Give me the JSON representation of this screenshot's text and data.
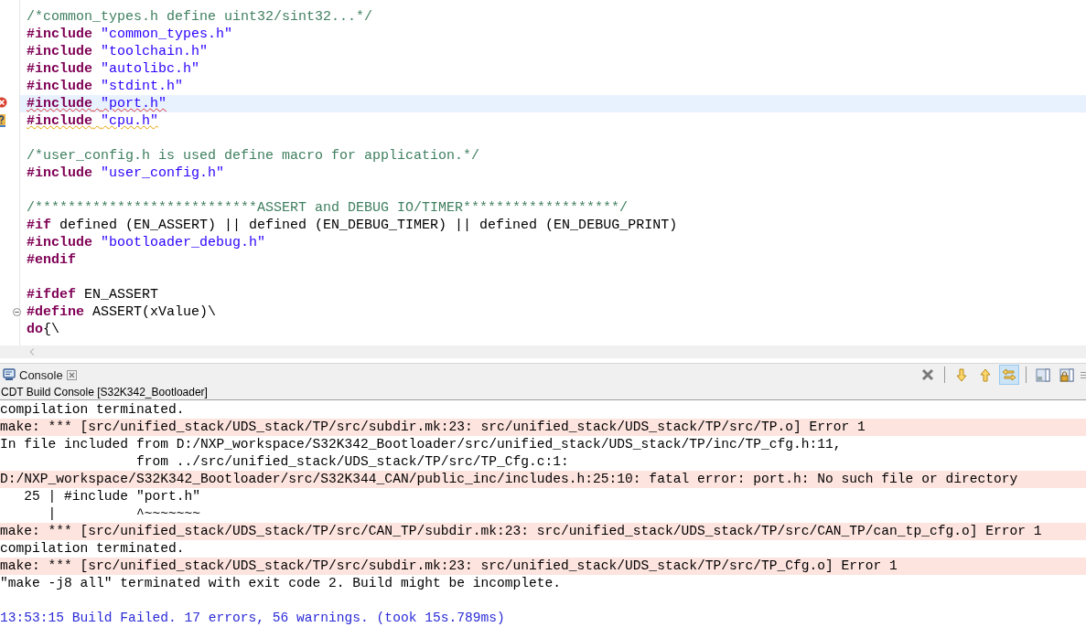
{
  "editor": {
    "lines": [
      {
        "parts": [
          {
            "kind": "comment",
            "text": "/*common_types.h define uint32/sint32...*/"
          }
        ]
      },
      {
        "parts": [
          {
            "kind": "keyword",
            "text": "#include"
          },
          {
            "kind": "string",
            "text": "\"common_types.h\""
          }
        ]
      },
      {
        "parts": [
          {
            "kind": "keyword",
            "text": "#include"
          },
          {
            "kind": "string",
            "text": "\"toolchain.h\""
          }
        ]
      },
      {
        "parts": [
          {
            "kind": "keyword",
            "text": "#include"
          },
          {
            "kind": "string",
            "text": "\"autolibc.h\""
          }
        ]
      },
      {
        "parts": [
          {
            "kind": "keyword",
            "text": "#include"
          },
          {
            "kind": "string",
            "text": "\"stdint.h\""
          }
        ]
      },
      {
        "parts": [
          {
            "kind": "keyword",
            "text": "#include"
          },
          {
            "kind": "string",
            "text": "\"port.h\""
          }
        ],
        "error": true,
        "selected": true
      },
      {
        "parts": [
          {
            "kind": "keyword",
            "text": "#include"
          },
          {
            "kind": "string",
            "text": "\"cpu.h\""
          }
        ],
        "warning": true
      },
      {
        "parts": [
          {
            "kind": "comment",
            "text": "/*user_config.h is used define macro for application.*/"
          }
        ],
        "space_before": true
      },
      {
        "parts": [
          {
            "kind": "keyword",
            "text": "#include"
          },
          {
            "kind": "string",
            "text": "\"user_config.h\""
          }
        ]
      },
      {
        "parts": [
          {
            "kind": "comment",
            "text": "/***************************ASSERT and DEBUG IO/TIMER*******************/"
          }
        ],
        "space_before": true
      },
      {
        "parts": [
          {
            "kind": "keyword",
            "text": "#if"
          },
          {
            "kind": "plain",
            "text": "defined (EN_ASSERT) || defined (EN_DEBUG_TIMER) || defined (EN_DEBUG_PRINT)"
          }
        ]
      },
      {
        "parts": [
          {
            "kind": "keyword",
            "text": "#include"
          },
          {
            "kind": "string",
            "text": "\"bootloader_debug.h\""
          }
        ]
      },
      {
        "parts": [
          {
            "kind": "keyword",
            "text": "#endif"
          }
        ]
      },
      {
        "parts": [
          {
            "kind": "keyword",
            "text": "#ifdef"
          },
          {
            "kind": "plain",
            "text": "EN_ASSERT"
          }
        ],
        "space_before": true
      },
      {
        "parts": [
          {
            "kind": "keyword",
            "text": "#define"
          },
          {
            "kind": "plain",
            "text": "ASSERT(xValue)\\"
          }
        ],
        "expanded": true
      },
      {
        "parts": [
          {
            "kind": "keyword",
            "text": "do"
          },
          {
            "kind": "plain",
            "text": "{\\",
            "joined": true
          }
        ]
      }
    ]
  },
  "console": {
    "tab": {
      "label": "Console"
    },
    "toolbar": [
      {
        "kind": "remove",
        "on": false
      },
      {
        "kind": "down",
        "on": false
      },
      {
        "kind": "up",
        "on": false
      },
      {
        "kind": "swap",
        "on": true
      },
      {
        "kind": "display",
        "on": false
      },
      {
        "kind": "lock",
        "on": false
      }
    ],
    "subtitle": "CDT Build Console [S32K342_Bootloader]",
    "lines": [
      {
        "kind": "plain",
        "text": "compilation terminated."
      },
      {
        "kind": "error",
        "text": "make: *** [src/unified_stack/UDS_stack/TP/src/subdir.mk:23: src/unified_stack/UDS_stack/TP/src/TP.o] Error 1"
      },
      {
        "kind": "plain",
        "text": "In file included from D:/NXP_workspace/S32K342_Bootloader/src/unified_stack/UDS_stack/TP/inc/TP_cfg.h:11,"
      },
      {
        "kind": "plain",
        "text": "                 from ../src/unified_stack/UDS_stack/TP/src/TP_Cfg.c:1:"
      },
      {
        "kind": "error",
        "text": "D:/NXP_workspace/S32K342_Bootloader/src/S32K344_CAN/public_inc/includes.h:25:10: fatal error: port.h: No such file or directory"
      },
      {
        "kind": "plain",
        "text": "   25 | #include \"port.h\""
      },
      {
        "kind": "plain",
        "text": "      |          ^~~~~~~~"
      },
      {
        "kind": "error",
        "text": "make: *** [src/unified_stack/UDS_stack/TP/src/CAN_TP/subdir.mk:23: src/unified_stack/UDS_stack/TP/src/CAN_TP/can_tp_cfg.o] Error 1"
      },
      {
        "kind": "plain",
        "text": "compilation terminated."
      },
      {
        "kind": "error",
        "text": "make: *** [src/unified_stack/UDS_stack/TP/src/subdir.mk:23: src/unified_stack/UDS_stack/TP/src/TP_Cfg.o] Error 1"
      },
      {
        "kind": "plain",
        "text": "\"make -j8 all\" terminated with exit code 2. Build might be incomplete."
      },
      {
        "kind": "status",
        "text": "13:53:15 Build Failed. 17 errors, 56 warnings. (took 15s.789ms)"
      }
    ]
  }
}
